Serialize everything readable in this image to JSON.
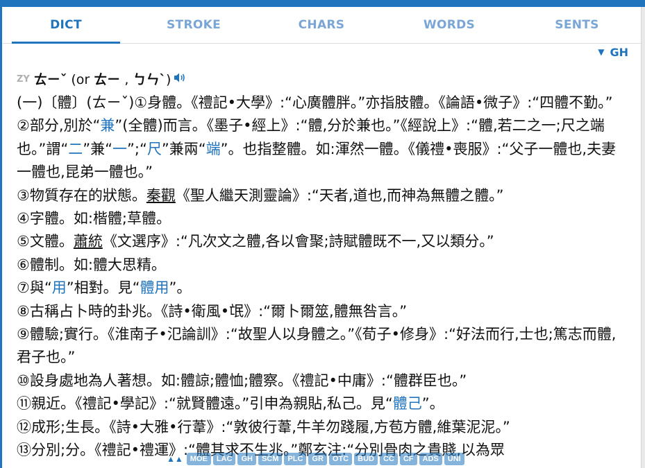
{
  "tabs": [
    "DICT",
    "STROKE",
    "CHARS",
    "WORDS",
    "SENTS"
  ],
  "gh_toggle": {
    "arrow": "▼",
    "label": "GH"
  },
  "pronunciation": {
    "zy": "ZY",
    "main": "ㄊㄧˇ",
    "or_prefix": " (or ",
    "alt1": "ㄊㄧ",
    "sep": " , ",
    "alt2": "ㄅㄣˋ",
    "close": ")",
    "speaker_icon": "speaker-icon"
  },
  "defs": [
    {
      "p1": "(一)〔體〕(ㄊㄧˇ)①身體。《禮記•大學》:“心廣體胖。”亦指肢體。《論語•微子》:“四體不勤。”"
    },
    {
      "p1": "②部分,別於“",
      "l1": "兼",
      "p2": "”(全體)而言。《墨子•經上》:“體,分於兼也。”《經說上》:“體,若二之一;尺之端也。”謂“",
      "l2": "二",
      "p3": "”兼“",
      "l3": "一",
      "p4": "”;“",
      "l4": "尺",
      "p5": "”兼兩“",
      "l5": "端",
      "p6": "”。也指整體。如:渾然一體。《儀禮•喪服》:“父子一體也,夫妻一體也,昆弟一體也。”"
    },
    {
      "p1": "③物質存在的狀態。",
      "u1": "秦觀",
      "p2": "《聖人繼天測靈論》:“天者,道也,而神為無體之體。”"
    },
    {
      "p1": "④字體。如:楷體;草體。"
    },
    {
      "p1": "⑤文體。",
      "u1": "蕭統",
      "p2": "《文選序》:“凡次文之體,各以會聚;詩賦體既不一,又以類分。”"
    },
    {
      "p1": "⑥體制。如:體大思精。"
    },
    {
      "p1": "⑦與“",
      "l1": "用",
      "p2": "”相對。見“",
      "l2": "體用",
      "p3": "”。"
    },
    {
      "p1": "⑧古稱占卜時的卦兆。《詩•衛風•氓》:“爾卜爾筮,體無咎言。”"
    },
    {
      "p1": "⑨體驗;實行。《淮南子•氾論訓》:“故聖人以身體之。”《荀子•修身》:“好法而行,士也;篤志而體,君子也。”"
    },
    {
      "p1": "⑩設身處地為人著想。如:體諒;體恤;體察。《禮記•中庸》:“體群臣也。”"
    },
    {
      "p1": "⑪親近。《禮記•學記》:“就賢體遠。”引申為親貼,私己。見“",
      "l1": "體己",
      "p2": "”。"
    },
    {
      "p1": "⑫成形;生長。《詩•大雅•行葦》:“敦彼行葦,牛羊勿踐履,方苞方體,維葉泥泥。”"
    },
    {
      "p1": "⑬分別;分。《禮記•禮運》:“體其求不生兆。”鄭玄注:“分別骨肉之貴賤,以為眾"
    }
  ],
  "footer": {
    "up_icon": "▲▲",
    "items": [
      "MOE",
      "LAC",
      "GH",
      "SCM",
      "PLC",
      "GR",
      "OTC",
      "BUD",
      "CC",
      "CF",
      "ADS",
      "UNI"
    ]
  },
  "colors": {
    "accent": "#1f74bd",
    "tab_inactive": "#79a6d6"
  }
}
